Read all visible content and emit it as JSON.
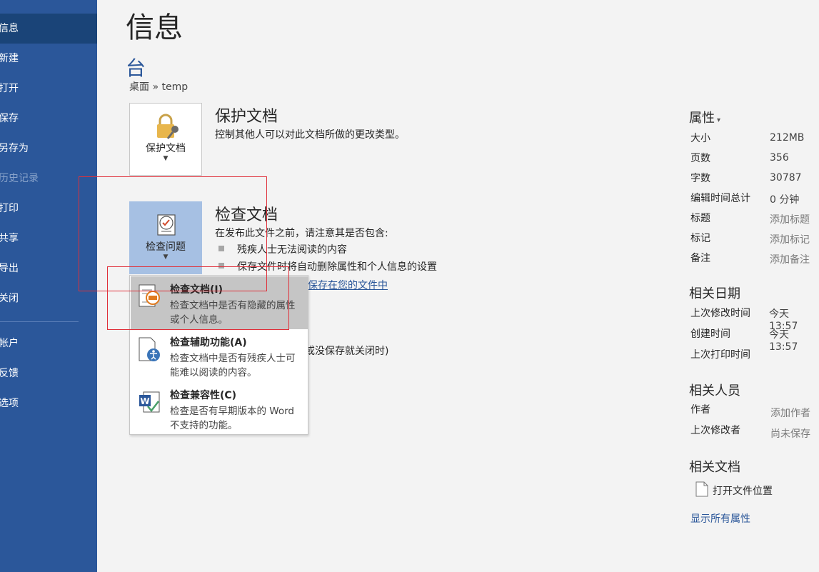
{
  "sidebar": {
    "items": [
      {
        "label": "信息"
      },
      {
        "label": "新建"
      },
      {
        "label": "打开"
      },
      {
        "label": "保存"
      },
      {
        "label": "另存为"
      },
      {
        "label": "历史记录"
      },
      {
        "label": "打印"
      },
      {
        "label": "共享"
      },
      {
        "label": "导出"
      },
      {
        "label": "关闭"
      },
      {
        "label": "帐户"
      },
      {
        "label": "反馈"
      },
      {
        "label": "选项"
      }
    ]
  },
  "main": {
    "title": "信息",
    "doc_name": "台",
    "path": "桌面 » temp",
    "protect": {
      "button_label": "保护文档",
      "heading": "保护文档",
      "desc": "控制其他人可以对此文档所做的更改类型。"
    },
    "inspect": {
      "button_label": "检查问题",
      "heading": "检查文档",
      "desc": "在发布此文件之前，请注意其是否包含:",
      "bullets": [
        "残疾人士无法阅读的内容",
        "保存文件时将自动删除属性和个人信息的设置"
      ],
      "link_partial": "保存在您的文件中"
    },
    "manage_partial": "或没保存就关闭时)"
  },
  "menu": {
    "items": [
      {
        "title": "检查文档(I)",
        "desc": "检查文档中是否有隐藏的属性或个人信息。"
      },
      {
        "title": "检查辅助功能(A)",
        "desc": "检查文档中是否有残疾人士可能难以阅读的内容。"
      },
      {
        "title": "检查兼容性(C)",
        "desc": "检查是否有早期版本的 Word 不支持的功能。"
      }
    ]
  },
  "properties": {
    "heading": "属性",
    "rows": [
      {
        "key": "大小",
        "value": "212MB"
      },
      {
        "key": "页数",
        "value": "356"
      },
      {
        "key": "字数",
        "value": "30787"
      },
      {
        "key": "编辑时间总计",
        "value": "0 分钟"
      },
      {
        "key": "标题",
        "value": "添加标题"
      },
      {
        "key": "标记",
        "value": "添加标记"
      },
      {
        "key": "备注",
        "value": "添加备注"
      }
    ]
  },
  "related_dates": {
    "heading": "相关日期",
    "rows": [
      {
        "key": "上次修改时间",
        "value": "今天 13:57"
      },
      {
        "key": "创建时间",
        "value": "今天 13:57"
      },
      {
        "key": "上次打印时间",
        "value": ""
      }
    ]
  },
  "related_people": {
    "heading": "相关人员",
    "rows": [
      {
        "key": "作者",
        "value": "添加作者"
      },
      {
        "key": "上次修改者",
        "value": "尚未保存"
      }
    ]
  },
  "related_docs": {
    "heading": "相关文档",
    "open_location": "打开文件位置",
    "show_all": "显示所有属性"
  },
  "colors": {
    "sidebar_bg": "#2b579a",
    "sidebar_selected": "#1a4478",
    "accent": "#2b579a",
    "annotation_red": "#e0303a"
  }
}
